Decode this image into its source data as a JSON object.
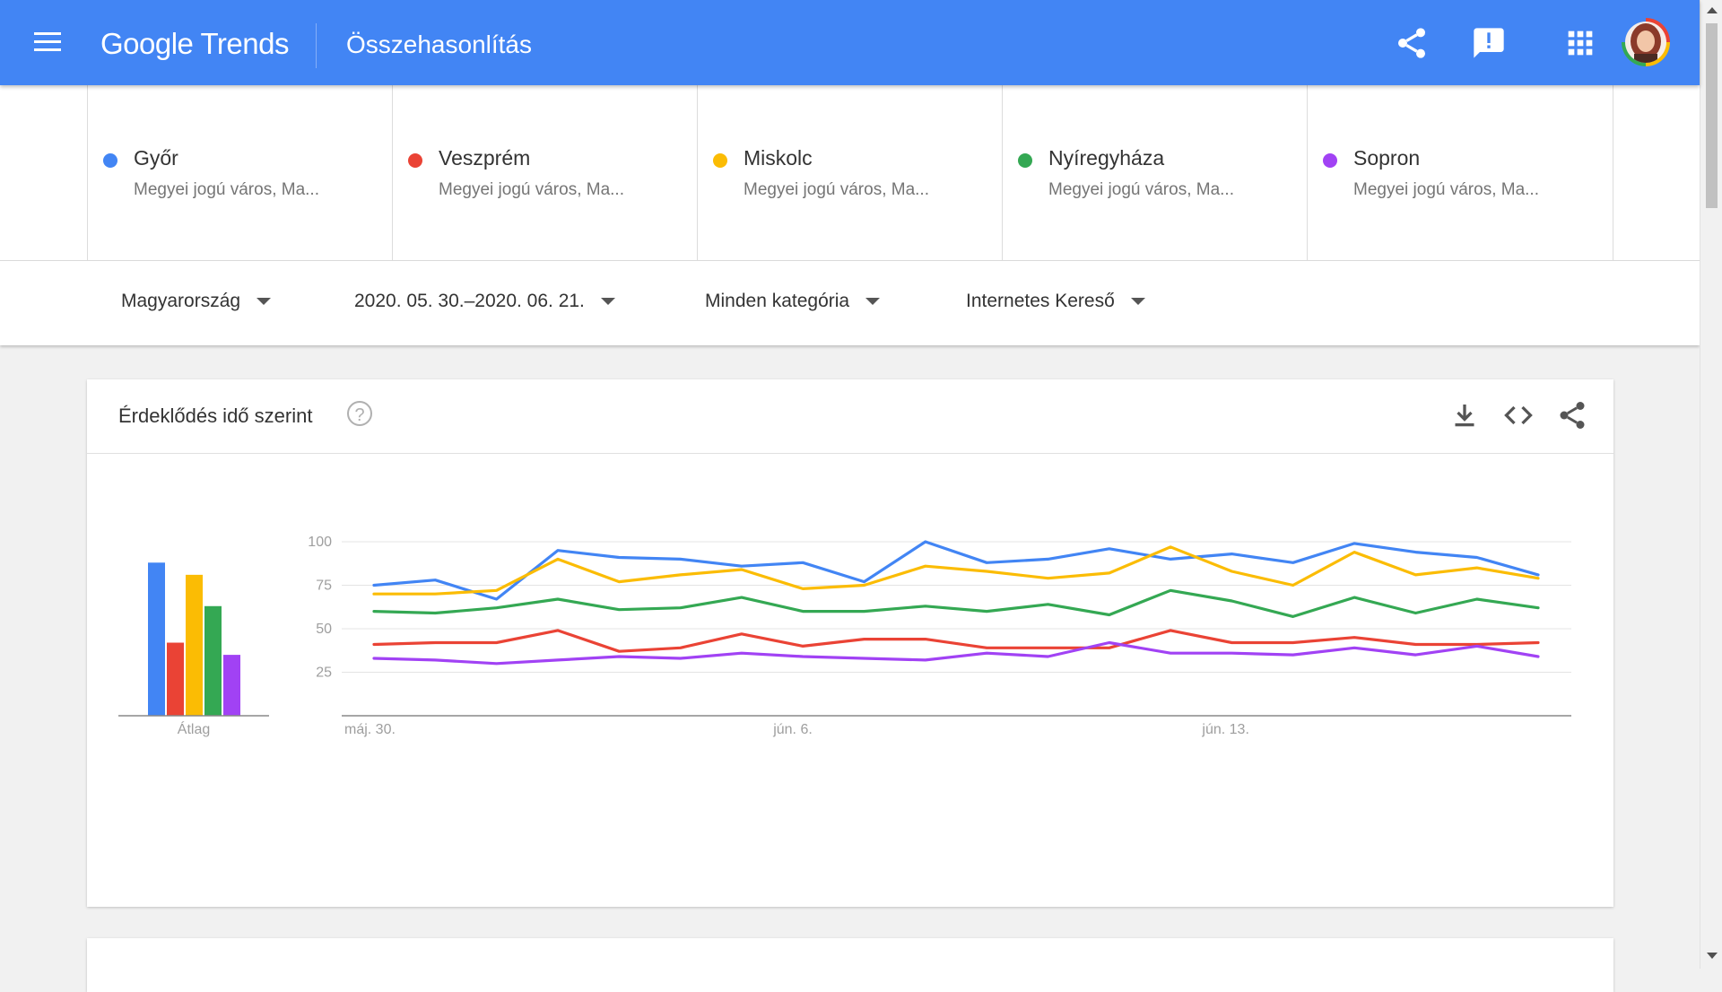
{
  "app": {
    "logo": "Google Trends",
    "title": "Összehasonlítás"
  },
  "icons": {
    "menu": "menu-icon",
    "share": "share-icon",
    "feedback": "feedback-icon",
    "apps": "apps-grid-icon",
    "avatar": "avatar"
  },
  "terms": [
    {
      "name": "Győr",
      "sub": "Megyei jogú város, Ma...",
      "color": "#4285f4"
    },
    {
      "name": "Veszprém",
      "sub": "Megyei jogú város, Ma...",
      "color": "#ea4335"
    },
    {
      "name": "Miskolc",
      "sub": "Megyei jogú város, Ma...",
      "color": "#fbbc04"
    },
    {
      "name": "Nyíregyháza",
      "sub": "Megyei jogú város, Ma...",
      "color": "#34a853"
    },
    {
      "name": "Sopron",
      "sub": "Megyei jogú város, Ma...",
      "color": "#a142f4"
    }
  ],
  "filters": {
    "region": "Magyarország",
    "daterange": "2020. 05. 30.–2020. 06. 21.",
    "category": "Minden kategória",
    "property": "Internetes Kereső"
  },
  "interest_card": {
    "title": "Érdeklődés idő szerint",
    "help": "?"
  },
  "chart_data": {
    "type": "line",
    "average_bars": {
      "label": "Átlag",
      "values": [
        88,
        42,
        81,
        63,
        35
      ],
      "colors": [
        "#4285f4",
        "#ea4335",
        "#fbbc04",
        "#34a853",
        "#a142f4"
      ]
    },
    "x_ticks": [
      {
        "index": 0,
        "label": "máj. 30."
      },
      {
        "index": 7,
        "label": "jún. 6."
      },
      {
        "index": 14,
        "label": "jún. 13."
      }
    ],
    "y_ticks": [
      100,
      75,
      50,
      25
    ],
    "ylim": [
      0,
      100
    ],
    "grid": true,
    "series": [
      {
        "name": "Győr",
        "color": "#4285f4",
        "values": [
          75,
          78,
          67,
          95,
          91,
          90,
          86,
          88,
          77,
          100,
          88,
          90,
          96,
          90,
          93,
          88,
          99,
          94,
          91,
          81
        ]
      },
      {
        "name": "Veszprém",
        "color": "#ea4335",
        "values": [
          41,
          42,
          42,
          49,
          37,
          39,
          47,
          40,
          44,
          44,
          39,
          39,
          39,
          49,
          42,
          42,
          45,
          41,
          41,
          42
        ]
      },
      {
        "name": "Miskolc",
        "color": "#fbbc04",
        "values": [
          70,
          70,
          72,
          90,
          77,
          81,
          84,
          73,
          75,
          86,
          83,
          79,
          82,
          97,
          83,
          75,
          94,
          81,
          85,
          79
        ]
      },
      {
        "name": "Nyíregyháza",
        "color": "#34a853",
        "values": [
          60,
          59,
          62,
          67,
          61,
          62,
          68,
          60,
          60,
          63,
          60,
          64,
          58,
          72,
          66,
          57,
          68,
          59,
          67,
          62
        ]
      },
      {
        "name": "Sopron",
        "color": "#a142f4",
        "values": [
          33,
          32,
          30,
          32,
          34,
          33,
          36,
          34,
          33,
          32,
          36,
          34,
          42,
          36,
          36,
          35,
          39,
          35,
          40,
          34
        ]
      }
    ]
  }
}
